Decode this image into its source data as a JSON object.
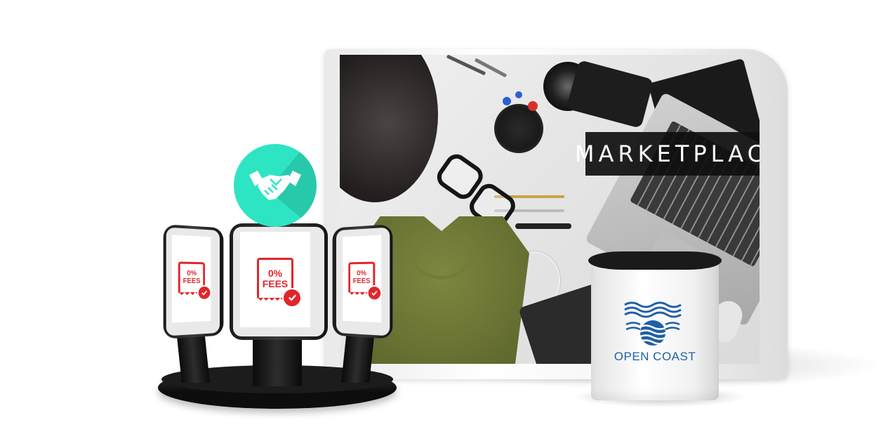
{
  "backwall": {
    "banner_text": "MARKETPLACE"
  },
  "counter": {
    "brand_name": "OPEN COAST",
    "logo_icon": "waves-logo-icon",
    "brand_color": "#1f5fa6"
  },
  "kiosks": [
    {
      "line1": "0%",
      "line2": "FEES",
      "icon": "receipt-check-icon"
    },
    {
      "line1": "0%",
      "line2": "FEES",
      "icon": "receipt-check-icon"
    },
    {
      "line1": "0%",
      "line2": "FEES",
      "icon": "receipt-check-icon"
    }
  ],
  "badge": {
    "icon": "handshake-icon",
    "color": "#2ee5c3"
  },
  "colors": {
    "fee_red": "#e0262b",
    "background": "#ffffff"
  }
}
